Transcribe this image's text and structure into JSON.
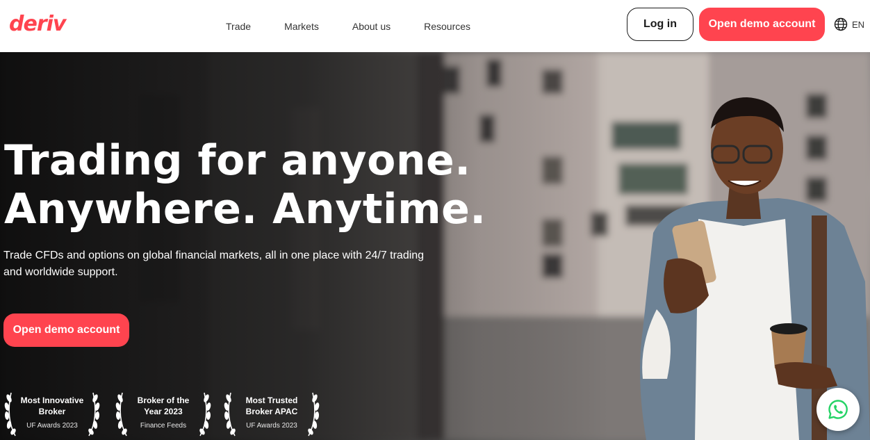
{
  "header": {
    "logo": "deriv",
    "nav": [
      {
        "label": "Trade"
      },
      {
        "label": "Markets"
      },
      {
        "label": "About us"
      },
      {
        "label": "Resources"
      }
    ],
    "login_label": "Log in",
    "demo_label": "Open demo account",
    "language": "EN",
    "language_icon": "globe-icon"
  },
  "hero": {
    "title_line1": "Trading for anyone.",
    "title_line2": "Anywhere. Anytime.",
    "subtitle": "Trade CFDs and options on global financial markets, all in one place with 24/7 trading and worldwide support.",
    "cta_label": "Open demo account"
  },
  "awards": [
    {
      "title_line1": "Most Innovative",
      "title_line2": "Broker",
      "source": "UF Awards 2023"
    },
    {
      "title_line1": "Broker of the",
      "title_line2": "Year 2023",
      "source": "Finance Feeds"
    },
    {
      "title_line1": "Most Trusted",
      "title_line2": "Broker APAC",
      "source": "UF Awards 2023"
    }
  ],
  "colors": {
    "brand_red": "#ff444f",
    "whatsapp_green": "#25d366"
  },
  "chat_icon": "whatsapp-icon"
}
